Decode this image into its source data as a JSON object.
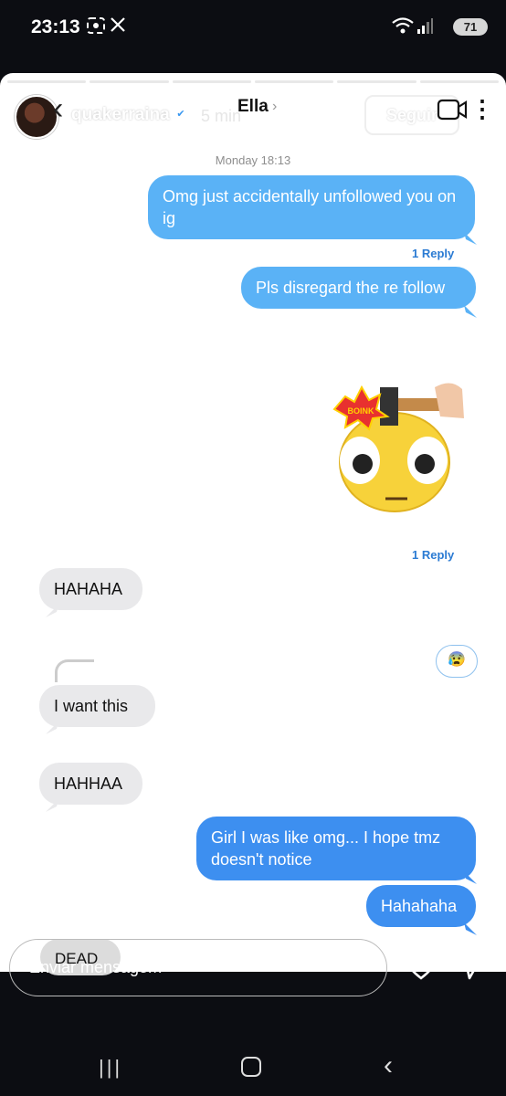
{
  "status_bar": {
    "time": "23:13",
    "icons": [
      "screenshot-icon",
      "x-icon",
      "wifi-icon",
      "signal-icon"
    ],
    "battery": "71"
  },
  "story": {
    "username": "quakerraina",
    "time_ago": "5 min",
    "follow_label": "Seguir"
  },
  "chat": {
    "contact_name": "Ella",
    "date_label": "Monday 18:13",
    "messages": [
      {
        "from": "me",
        "text": "Omg just accidentally unfollowed you on ig",
        "reply": "1 Reply"
      },
      {
        "from": "me",
        "text": "Pls disregard the re follow"
      },
      {
        "from": "me",
        "type": "sticker",
        "reply": "1 Reply"
      },
      {
        "from": "them",
        "text": "HAHAHA"
      },
      {
        "from": "them",
        "text": "I want this"
      },
      {
        "from": "them",
        "text": "HAHHAA"
      },
      {
        "from": "me",
        "text": "Girl I was like omg... I hope tmz doesn't notice"
      },
      {
        "from": "me",
        "text": "Hahahaha"
      },
      {
        "from": "them",
        "text": "DEAD"
      }
    ],
    "sticker_caption": "BOINK",
    "reaction_emoji": "😰"
  },
  "reply_bar": {
    "placeholder": "Enviar mensagem"
  },
  "colors": {
    "sent_bubble": "#5ab2f6",
    "sent_bubble_dark": "#3d8ff0",
    "received_bubble": "#e9e9eb",
    "reply_link": "#2b7bd3"
  }
}
